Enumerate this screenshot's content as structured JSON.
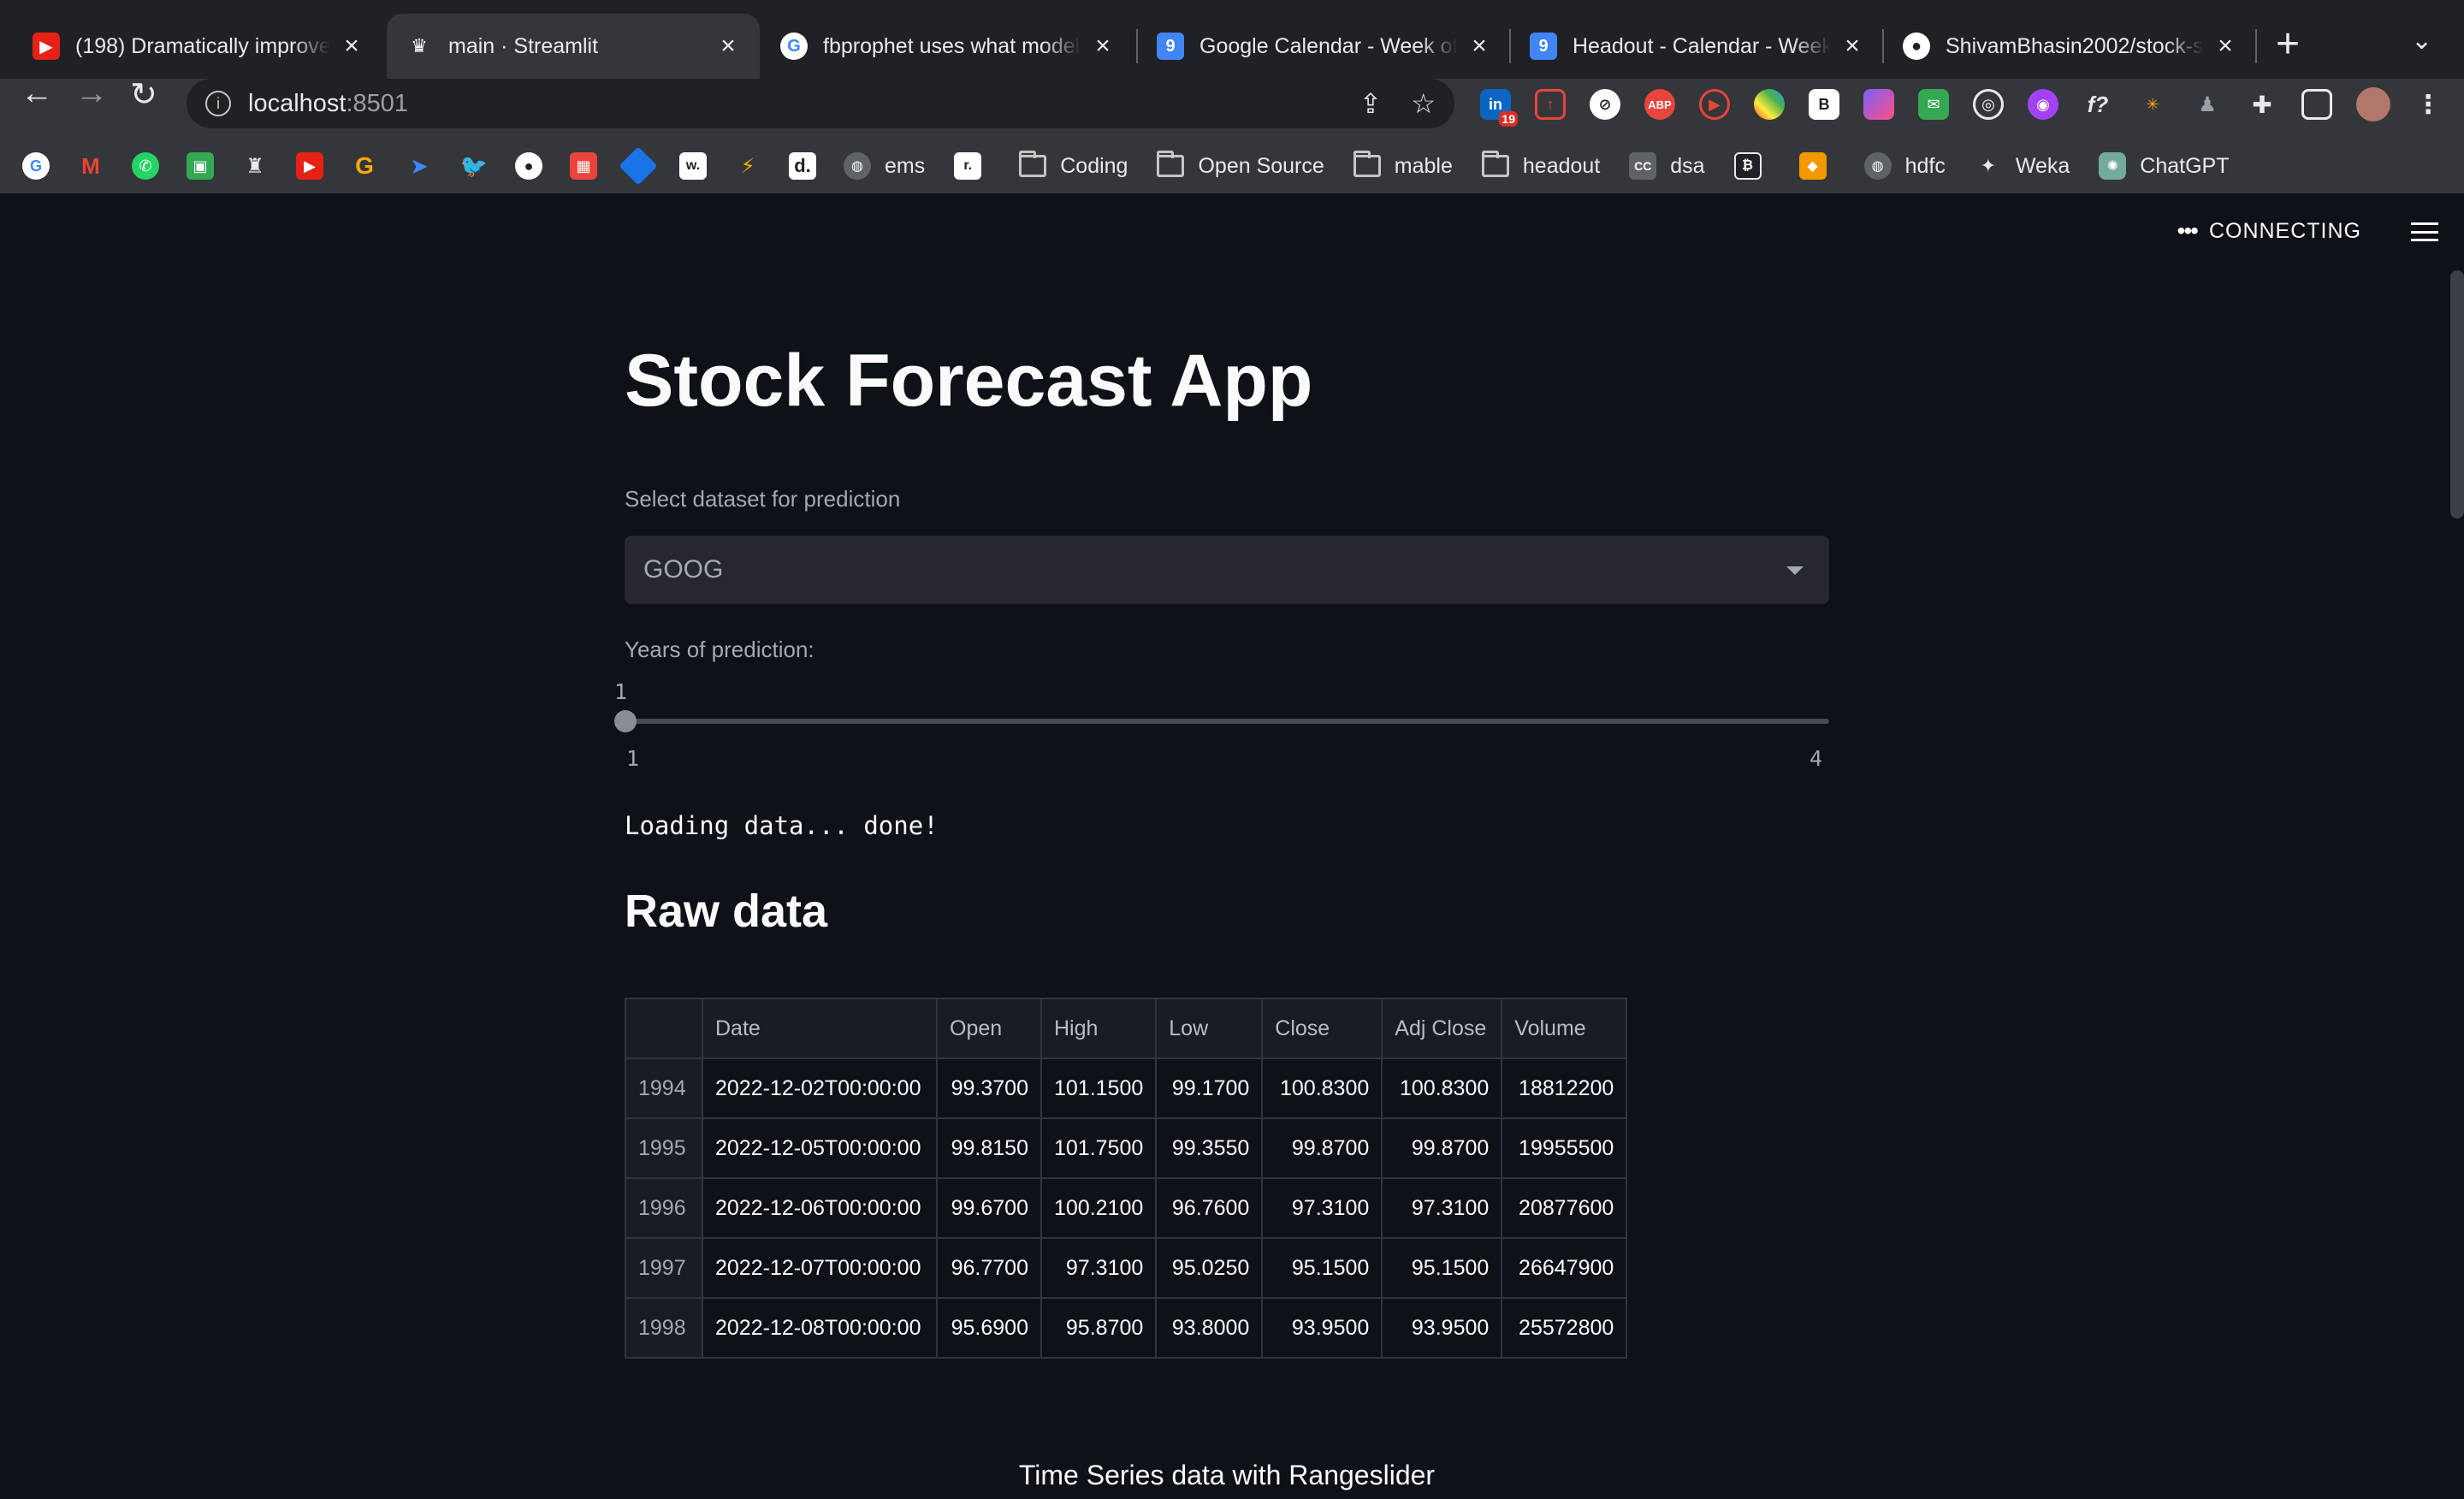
{
  "browser": {
    "tabs": [
      {
        "title": "(198) Dramatically improve",
        "icon": "youtube-icon",
        "color": "#e62117"
      },
      {
        "title": "main · Streamlit",
        "icon": "streamlit-icon",
        "color": "#35363a"
      },
      {
        "title": "fbprophet uses what model",
        "icon": "google-icon",
        "color": "#ffffff"
      },
      {
        "title": "Google Calendar - Week of",
        "icon": "calendar-icon",
        "color": "#4285f4"
      },
      {
        "title": "Headout - Calendar - Week",
        "icon": "calendar-icon",
        "color": "#4285f4"
      },
      {
        "title": "ShivamBhasin2002/stock-s",
        "icon": "github-icon",
        "color": "#ffffff"
      }
    ],
    "url_host": "localhost",
    "url_port": ":8501",
    "extension_badge": "19",
    "bookmarks": [
      {
        "label": "ems",
        "type": "globe"
      },
      {
        "label": "Coding",
        "type": "folder"
      },
      {
        "label": "Open Source",
        "type": "folder"
      },
      {
        "label": "mable",
        "type": "folder"
      },
      {
        "label": "headout",
        "type": "folder"
      },
      {
        "label": "dsa",
        "type": "cc"
      },
      {
        "label": "hdfc",
        "type": "globe"
      },
      {
        "label": "Weka",
        "type": "weka"
      },
      {
        "label": "ChatGPT",
        "type": "chatgpt"
      }
    ]
  },
  "app": {
    "status": "CONNECTING",
    "title": "Stock Forecast App",
    "dataset_label": "Select dataset for prediction",
    "dataset_value": "GOOG",
    "years_label": "Years of prediction:",
    "years_value": "1",
    "years_min": "1",
    "years_max": "4",
    "loading_text": "Loading data... done!",
    "raw_data_heading": "Raw data",
    "table": {
      "columns": [
        "",
        "Date",
        "Open",
        "High",
        "Low",
        "Close",
        "Adj Close",
        "Volume"
      ],
      "rows": [
        [
          "1994",
          "2022-12-02T00:00:00",
          "99.3700",
          "101.1500",
          "99.1700",
          "100.8300",
          "100.8300",
          "18812200"
        ],
        [
          "1995",
          "2022-12-05T00:00:00",
          "99.8150",
          "101.7500",
          "99.3550",
          "99.8700",
          "99.8700",
          "19955500"
        ],
        [
          "1996",
          "2022-12-06T00:00:00",
          "99.6700",
          "100.2100",
          "96.7600",
          "97.3100",
          "97.3100",
          "20877600"
        ],
        [
          "1997",
          "2022-12-07T00:00:00",
          "96.7700",
          "97.3100",
          "95.0250",
          "95.1500",
          "95.1500",
          "26647900"
        ],
        [
          "1998",
          "2022-12-08T00:00:00",
          "95.6900",
          "95.8700",
          "93.8000",
          "93.9500",
          "93.9500",
          "25572800"
        ]
      ]
    },
    "chart_caption": "Time Series data with Rangeslider"
  }
}
